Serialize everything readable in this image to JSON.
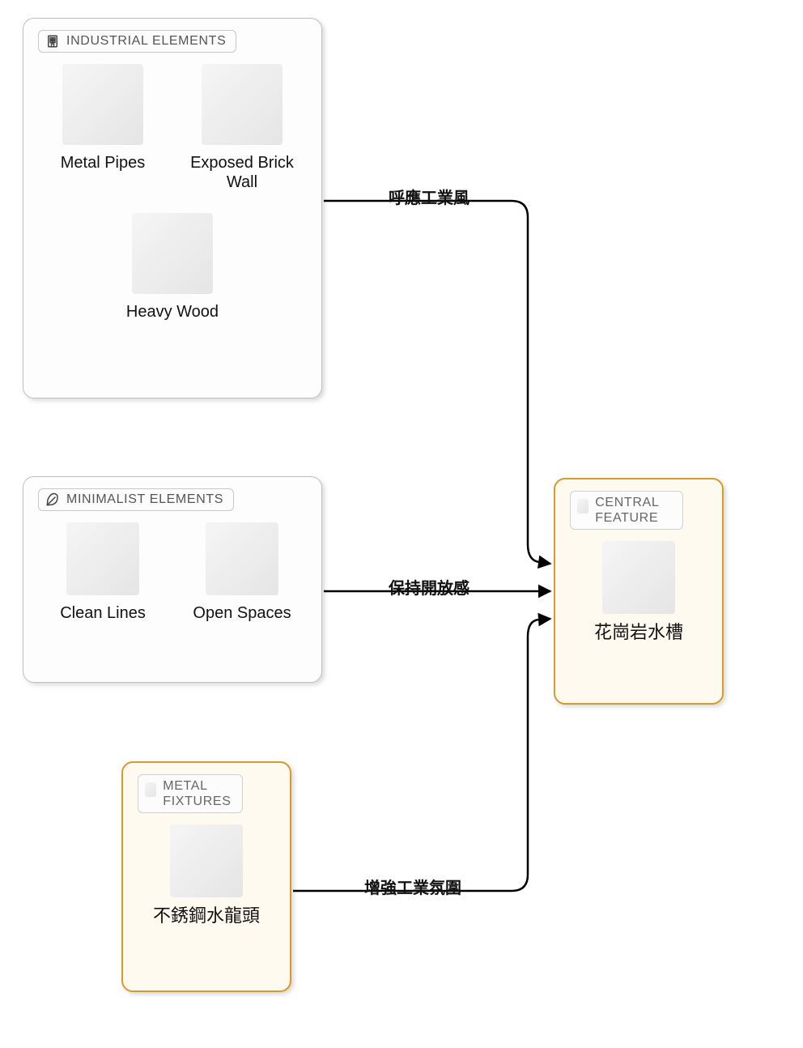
{
  "panels": {
    "industrial": {
      "title": "INDUSTRIAL ELEMENTS",
      "icon": "building-icon",
      "items": [
        "Metal Pipes",
        "Exposed Brick Wall",
        "Heavy Wood"
      ]
    },
    "minimalist": {
      "title": "MINIMALIST ELEMENTS",
      "icon": "feather-icon",
      "items": [
        "Clean Lines",
        "Open Spaces"
      ]
    },
    "fixtures": {
      "title": "METAL FIXTURES",
      "items": [
        "不銹鋼水龍頭"
      ]
    },
    "central": {
      "title": "CENTRAL FEATURE",
      "items": [
        "花崗岩水槽"
      ]
    }
  },
  "edges": {
    "industrial_to_central": "呼應工業風",
    "minimalist_to_central": "保持開放感",
    "fixtures_to_central": "增強工業氛圍"
  }
}
